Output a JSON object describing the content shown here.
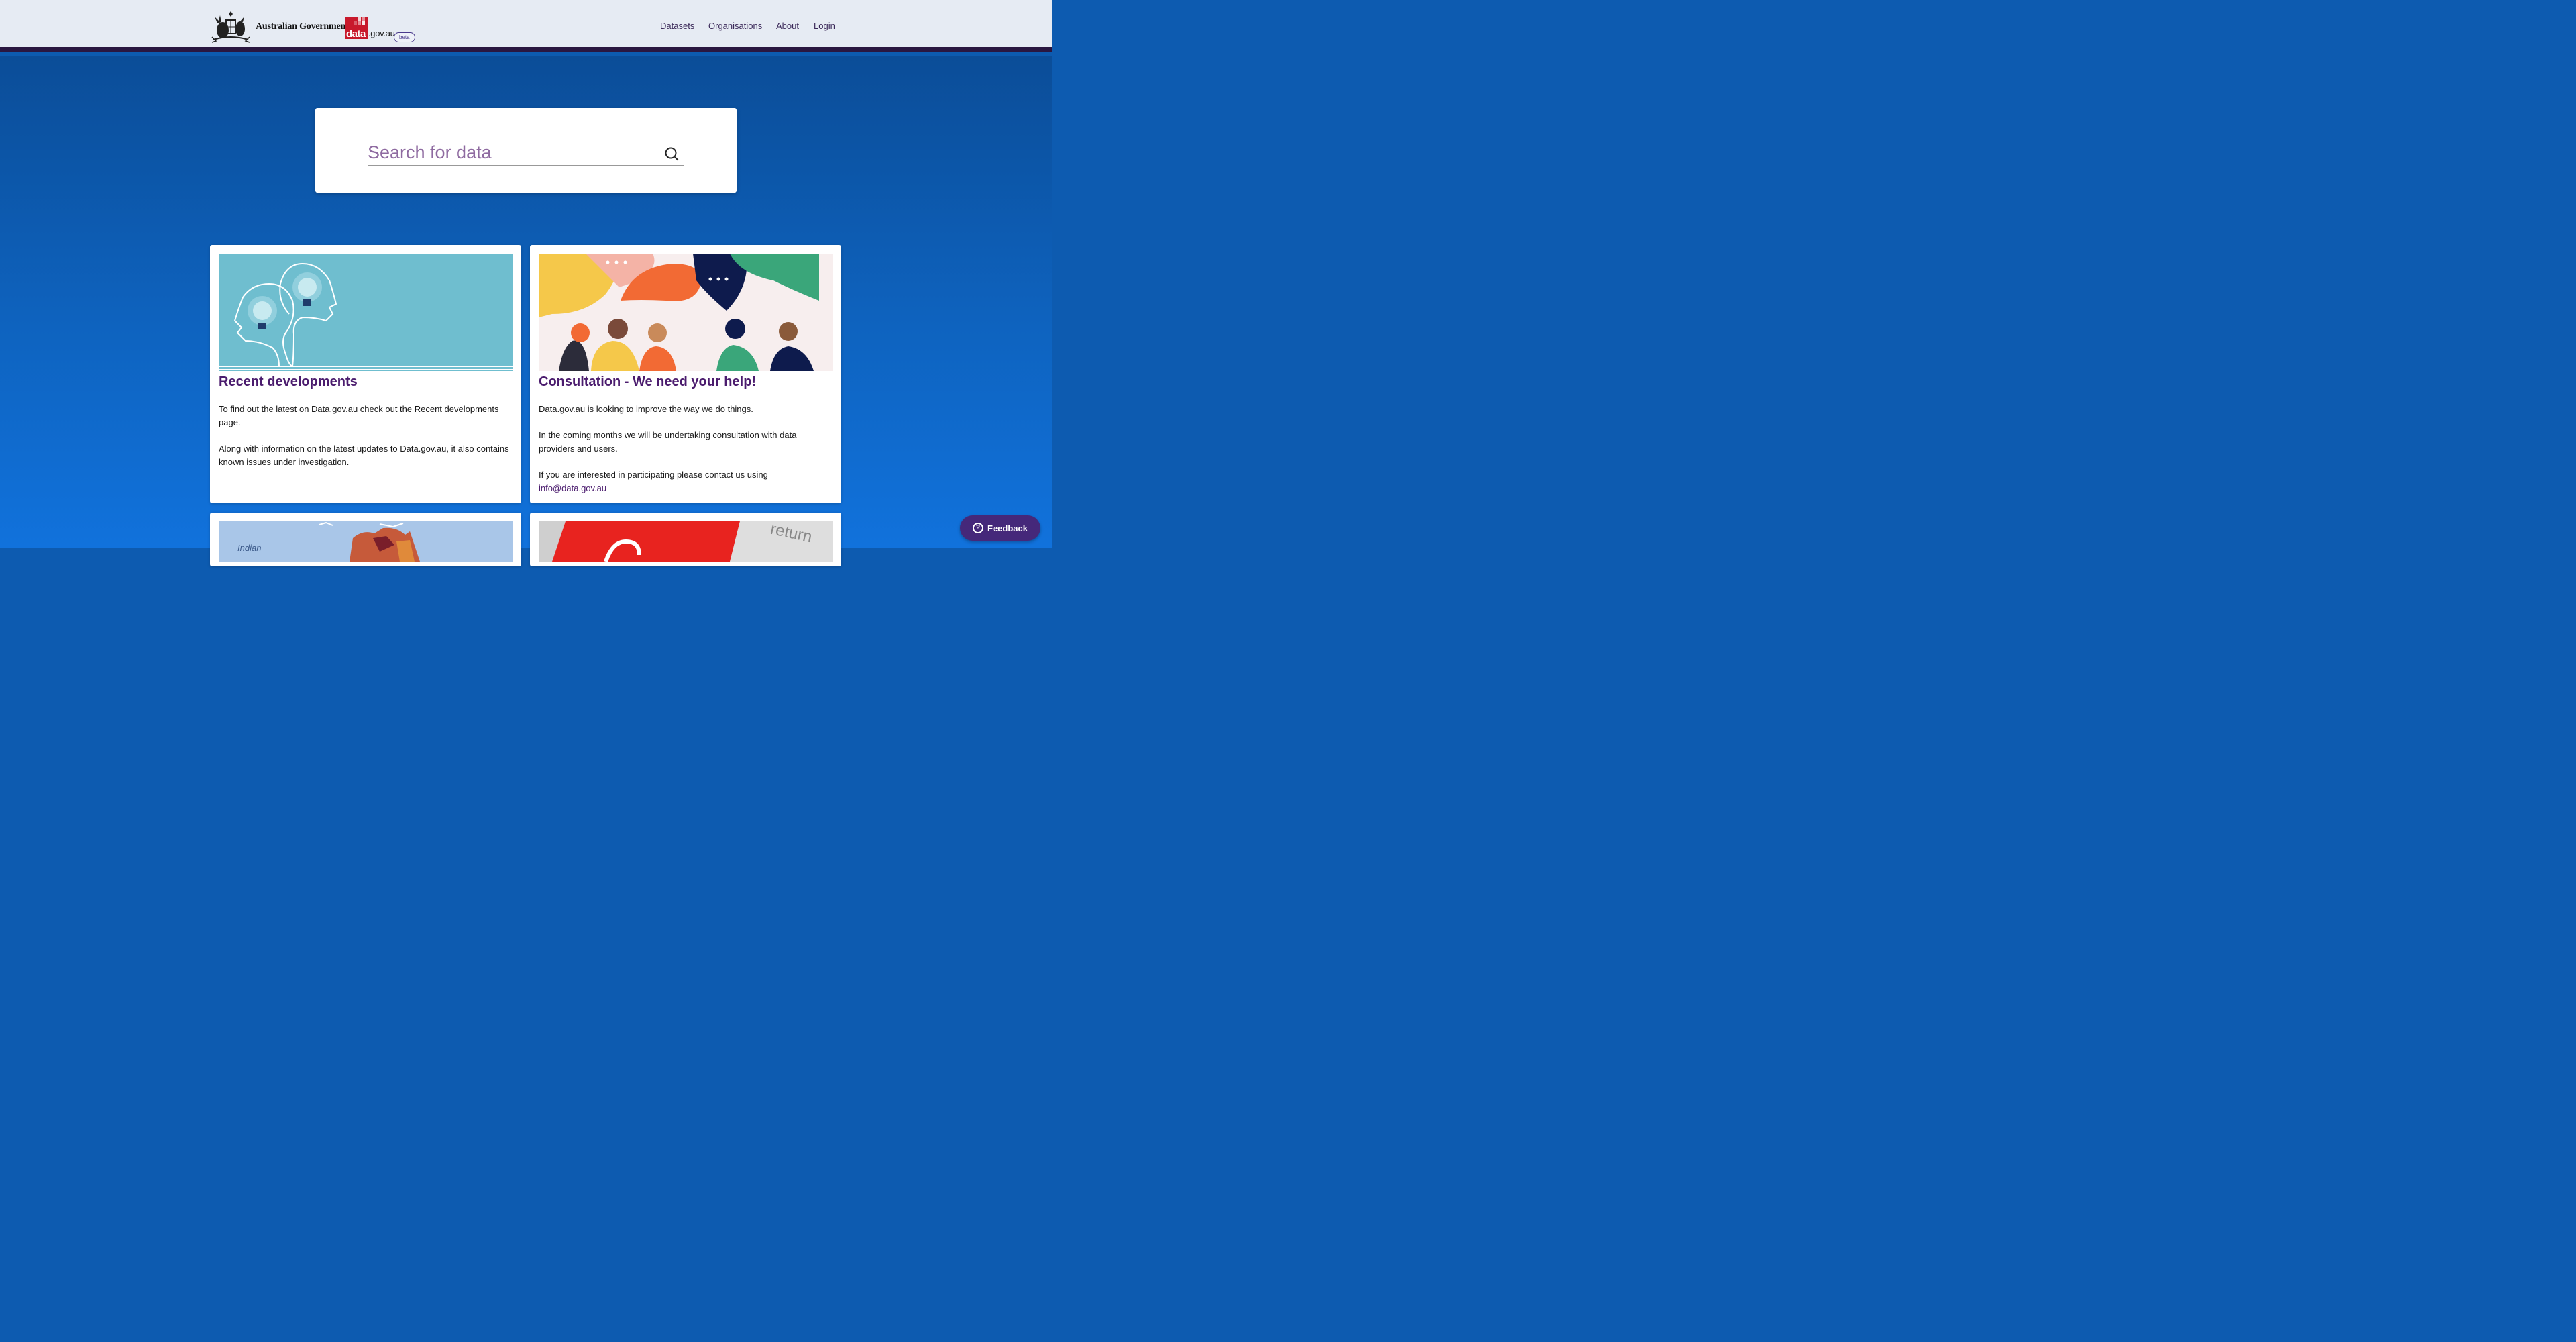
{
  "header": {
    "gov_name": "Australian Government",
    "logo_data": "data",
    "logo_domain": ".gov.au",
    "beta": "beta",
    "nav": [
      {
        "label": "Datasets"
      },
      {
        "label": "Organisations"
      },
      {
        "label": "About"
      },
      {
        "label": "Login"
      }
    ]
  },
  "search": {
    "placeholder": "Search for data"
  },
  "cards": [
    {
      "title": "Recent developments",
      "paragraphs": [
        "To find out the latest on Data.gov.au check out the Recent developments page.",
        "Along with information on the latest updates to Data.gov.au, it also contains known issues under investigation."
      ]
    },
    {
      "title": "Consultation - We need your help!",
      "paragraphs": [
        "Data.gov.au is looking to improve the way we do things.",
        "In the coming months we will be undertaking consultation with data providers and users.",
        "If you are interested in participating please contact us using"
      ],
      "email": "info@data.gov.au"
    },
    {
      "map_label": "Indian"
    },
    {
      "sign_text": "return"
    }
  ],
  "feedback": {
    "label": "Feedback"
  },
  "colors": {
    "brand_purple": "#4b1c6e",
    "header_bar": "#2a1740",
    "hero_blue": "#0d5bb0",
    "data_red": "#c8192c",
    "feedback_bg": "#45287a"
  }
}
